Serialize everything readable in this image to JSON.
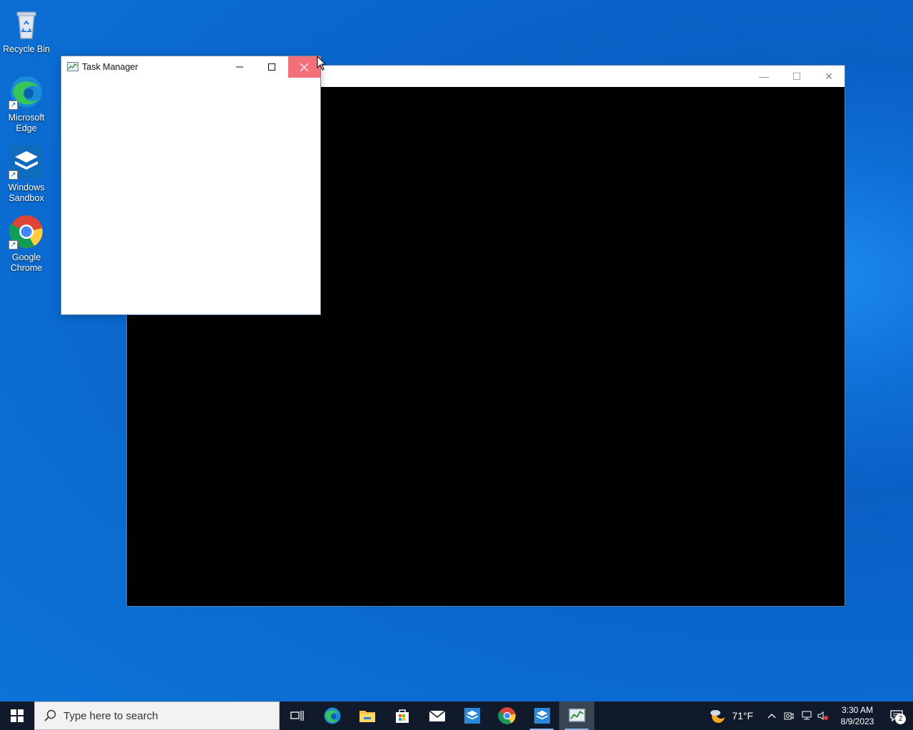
{
  "desktop": {
    "icons": [
      {
        "label_line1": "Recycle Bin",
        "label_line2": ""
      },
      {
        "label_line1": "Microsoft",
        "label_line2": "Edge"
      },
      {
        "label_line1": "Windows",
        "label_line2": "Sandbox"
      },
      {
        "label_line1": "Google",
        "label_line2": "Chrome"
      }
    ]
  },
  "task_manager": {
    "title": "Task Manager",
    "close_glyph": "✕",
    "minimize_glyph": "—",
    "maximize_glyph": "☐"
  },
  "background_window": {
    "minimize_glyph": "—",
    "maximize_glyph": "☐",
    "close_glyph": "✕"
  },
  "taskbar": {
    "search_placeholder": "Type here to search",
    "apps": [
      "task-view",
      "edge",
      "file-explorer",
      "store",
      "mail",
      "windows-sandbox",
      "chrome",
      "windows-sandbox-running",
      "task-manager"
    ],
    "weather_temp": "71°F",
    "time": "3:30 AM",
    "date": "8/9/2023",
    "notification_count": "2"
  },
  "colors": {
    "close_hover": "#f1707a",
    "taskbar": "#101a2a",
    "desktop_accent": "#0a5fc4"
  }
}
